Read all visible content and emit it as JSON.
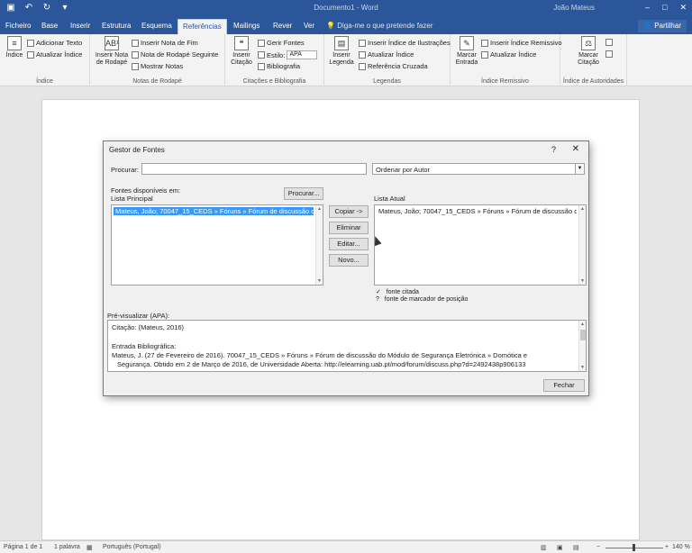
{
  "window": {
    "title": "Documento1 - Word",
    "user": "João Mateus"
  },
  "tabs": {
    "file": "Ficheiro",
    "home": "Base",
    "insert": "Inserir",
    "design": "Estrutura",
    "layout": "Esquema",
    "references": "Referências",
    "mailings": "Mailings",
    "review": "Rever",
    "view": "Ver",
    "tell_me": "Diga-me o que pretende fazer",
    "share": "Partilhar"
  },
  "ribbon": {
    "index_group": {
      "big": "Índice",
      "add_text": "Adicionar Texto",
      "update": "Atualizar Índice",
      "label": "Índice"
    },
    "footnotes_group": {
      "big1": "Inserir Nota",
      "big2": "de Rodapé",
      "insert_endnote": "Inserir Nota de Fim",
      "next_footnote": "Nota de Rodapé Seguinte",
      "show_notes": "Mostrar Notas",
      "label": "Notas de Rodapé"
    },
    "citations_group": {
      "big1": "Inserir",
      "big2": "Citação",
      "manage_sources": "Gerir Fontes",
      "style_label": "Estilo:",
      "style_value": "APA",
      "bibliography": "Bibliografia",
      "label": "Citações e Bibliografia"
    },
    "captions_group": {
      "big1": "Inserir",
      "big2": "Legenda",
      "insert_table_figures": "Inserir Índice de Ilustrações",
      "update_table": "Atualizar Índice",
      "cross_reference": "Referência Cruzada",
      "label": "Legendas"
    },
    "index2_group": {
      "big1": "Marcar",
      "big2": "Entrada",
      "insert_index": "Inserir Índice Remissivo",
      "update_index": "Atualizar Índice",
      "label": "Índice Remissivo"
    },
    "authorities_group": {
      "big1": "Marcar",
      "big2": "Citação",
      "label": "Índice de Autoridades"
    }
  },
  "dialog": {
    "title": "Gestor de Fontes",
    "help": "?",
    "close": "✕",
    "search_label": "Procurar:",
    "search_value": "",
    "sort_value": "Ordenar por Autor",
    "available_label": "Fontes disponíveis em:",
    "master_list_label": "Lista Principal",
    "browse_button": "Procurar...",
    "master_item": "Mateus, João; 70047_15_CEDS » Fóruns » Fórum de discussão do Módulo",
    "current_list_label": "Lista Atual",
    "current_item": "Mateus, João; 70047_15_CEDS » Fóruns » Fórum de discussão do Mó",
    "copy_button": "Copiar ->",
    "delete_button": "Eliminar",
    "edit_button": "Editar...",
    "new_button": "Novo...",
    "legend_cited_mark": "✓",
    "legend_cited": "fonte citada",
    "legend_placeholder_mark": "?",
    "legend_placeholder": "fonte de marcador de posição",
    "preview_label": "Pré-visualizar (APA):",
    "preview_citation": "Citação: (Mateus, 2016)",
    "preview_bib_heading": "Entrada Bibliográfica:",
    "preview_bib_line1": "Mateus, J. (27 de Fevereiro de 2016). 70047_15_CEDS » Fóruns » Fórum de discussão do Módulo de Segurança Eletrónica » Domótica e",
    "preview_bib_line2": "Segurança. Obtido em 2 de Março de 2016, de Universidade Aberta: http://elearning.uab.pt/mod/forum/discuss.php?d=2492438p906133",
    "close_button": "Fechar"
  },
  "status": {
    "page": "Página 1 de 1",
    "words": "1 palavra",
    "language": "Português (Portugal)",
    "zoom": "140 %"
  },
  "colors": {
    "accent": "#2b579a",
    "selection": "#3399ff"
  }
}
